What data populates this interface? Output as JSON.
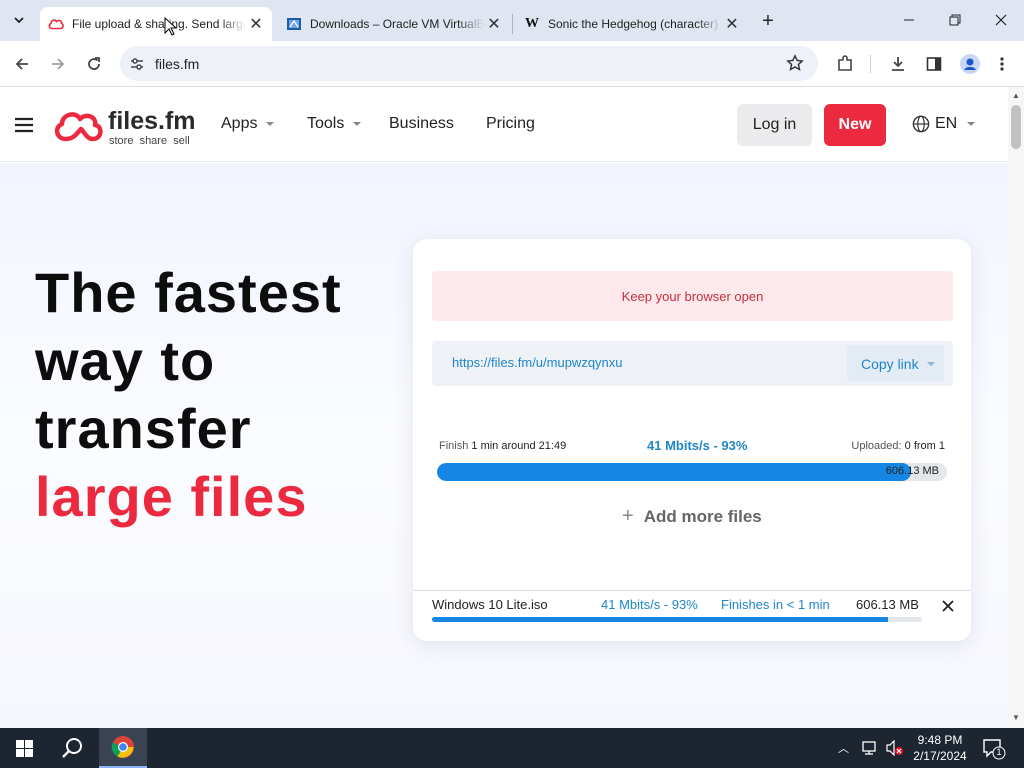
{
  "browser": {
    "tabs": [
      {
        "title": "File upload & sharing. Send large files",
        "icon": "filesfm-logo-icon",
        "active": true
      },
      {
        "title": "Downloads – Oracle VM VirtualBox",
        "icon": "virtualbox-icon",
        "active": false
      },
      {
        "title": "Sonic the Hedgehog (character)",
        "icon": "wikipedia-icon",
        "active": false
      }
    ],
    "url": "files.fm"
  },
  "site": {
    "logo_name": "files.fm",
    "logo_tagline": "store  share  sell",
    "nav": {
      "apps": "Apps",
      "tools": "Tools",
      "business": "Business",
      "pricing": "Pricing",
      "login": "Log in",
      "new": "New",
      "lang": "EN"
    }
  },
  "hero": {
    "line1": "The fastest",
    "line2": "way to",
    "line3": "transfer",
    "line4": "large files"
  },
  "upload": {
    "notice": "Keep your browser open",
    "link": "https://files.fm/u/mupwzqynxu",
    "copy_label": "Copy link",
    "finish_label": "Finish",
    "finish_value": "1 min around 21:49",
    "speed": "41 Mbits/s - 93%",
    "uploaded_label": "Uploaded:",
    "uploaded_value": "0 from 1",
    "size": "606.13 MB",
    "progress": 0.93,
    "add_more": "Add more files",
    "file": {
      "name": "Windows 10 Lite.iso",
      "speed": "41 Mbits/s - 93%",
      "eta": "Finishes in < 1 min",
      "size": "606.13 MB",
      "progress": 0.93
    }
  },
  "colors": {
    "brand_red": "#ec2a3f",
    "progress_blue": "#1686e4",
    "link_blue": "#1f86c8"
  },
  "taskbar": {
    "time": "9:48 PM",
    "date": "2/17/2024",
    "notification_count": "1"
  }
}
